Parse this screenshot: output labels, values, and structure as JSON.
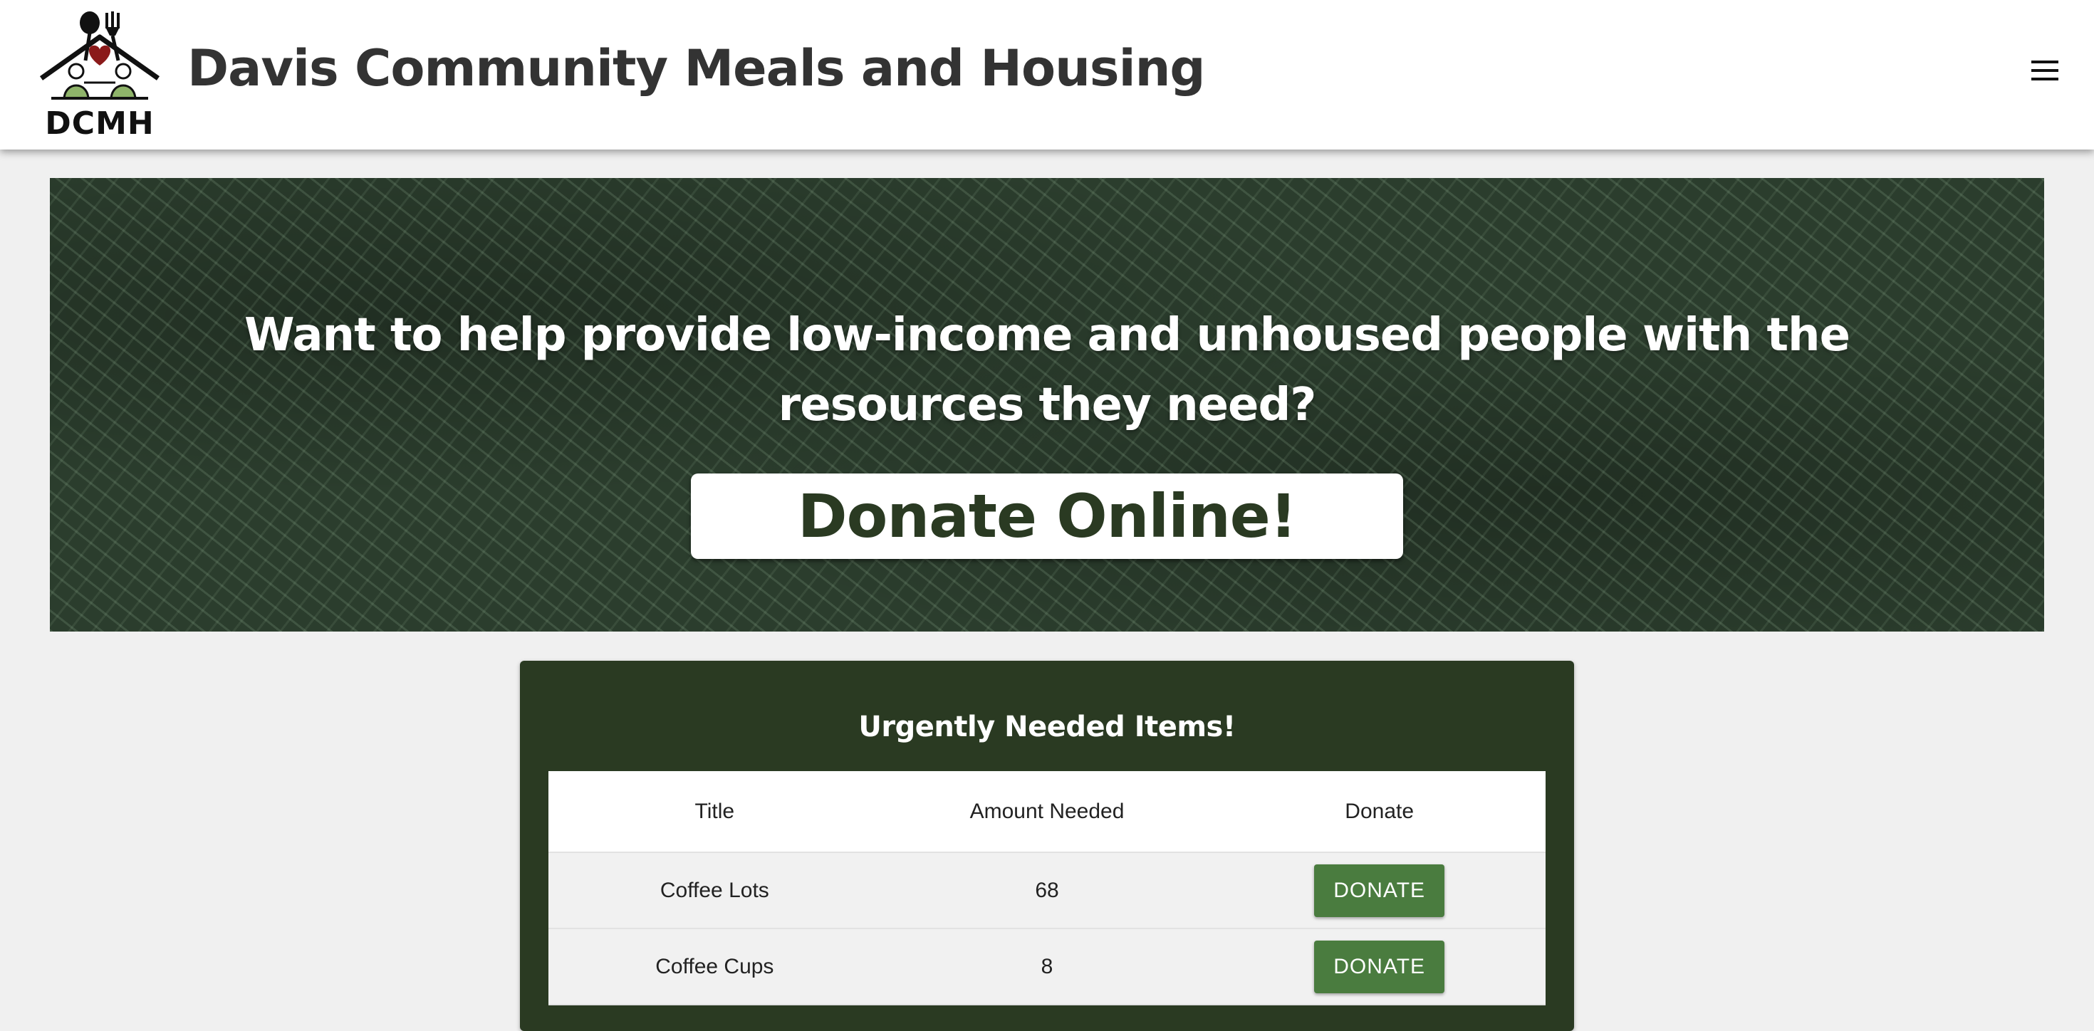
{
  "header": {
    "logo_text": "DCMH",
    "title": "Davis Community Meals and Housing"
  },
  "icons": {
    "logo": "house-roof-with-spoon-fork-heart-people",
    "menu": "hamburger-menu-icon"
  },
  "hero": {
    "heading": "Want to help provide low-income and unhoused people with the resources they need?",
    "button_label": "Donate Online!"
  },
  "urgent": {
    "title": "Urgently Needed Items!",
    "columns": [
      "Title",
      "Amount Needed",
      "Donate"
    ],
    "rows": [
      {
        "title": "Coffee Lots",
        "amount": "68",
        "button": "DONATE"
      },
      {
        "title": "Coffee Cups",
        "amount": "8",
        "button": "DONATE"
      }
    ]
  },
  "colors": {
    "hero_bg": "#2b3d2d",
    "card_bg": "#2a3a22",
    "button_green": "#4a7c3f",
    "page_bg": "#f0f0f0"
  }
}
